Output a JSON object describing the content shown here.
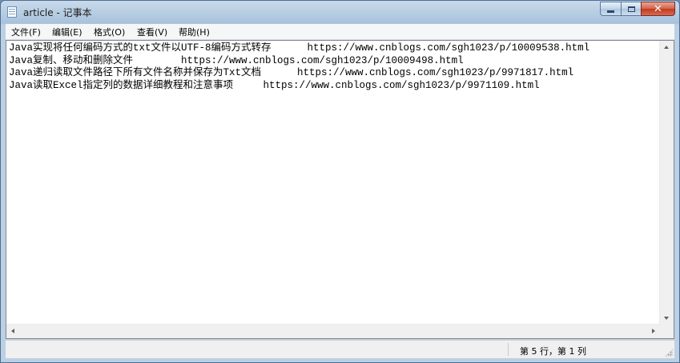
{
  "window": {
    "title": "article - 记事本",
    "icon": "notepad-icon",
    "controls": {
      "minimize": "minimize-icon",
      "maximize": "maximize-icon",
      "close": "✕"
    }
  },
  "menu": {
    "items": [
      {
        "label": "文件(F)"
      },
      {
        "label": "编辑(E)"
      },
      {
        "label": "格式(O)"
      },
      {
        "label": "查看(V)"
      },
      {
        "label": "帮助(H)"
      }
    ]
  },
  "editor": {
    "lines": [
      "Java实现将任何编码方式的txt文件以UTF-8编码方式转存      https://www.cnblogs.com/sgh1023/p/10009538.html",
      "Java复制、移动和删除文件        https://www.cnblogs.com/sgh1023/p/10009498.html",
      "Java递归读取文件路径下所有文件名称并保存为Txt文档      https://www.cnblogs.com/sgh1023/p/9971817.html",
      "Java读取Excel指定列的数据详细教程和注意事项     https://www.cnblogs.com/sgh1023/p/9971109.html",
      ""
    ]
  },
  "status": {
    "position": "第 5 行，第 1 列"
  },
  "colors": {
    "title_bar": "#c9daea",
    "close_button": "#c1391f",
    "editor_bg": "#ffffff",
    "menu_bg": "#f5f6f7"
  }
}
